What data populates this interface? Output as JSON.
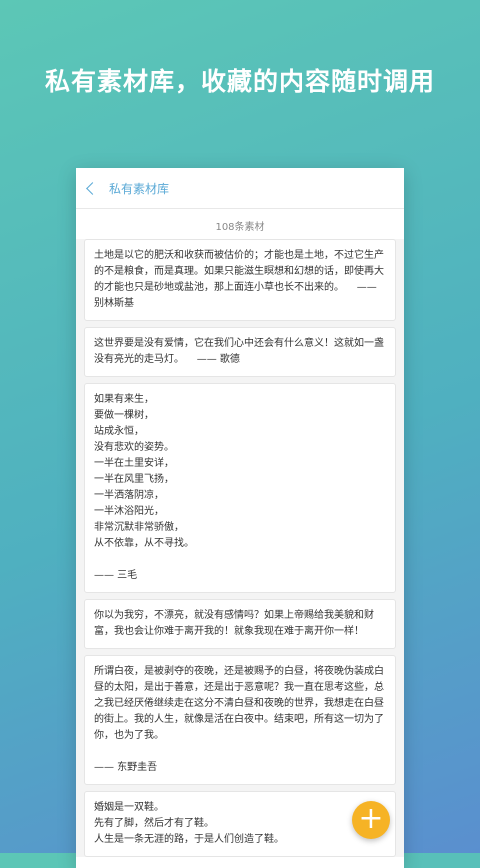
{
  "headline": "私有素材库，收藏的内容随时调用",
  "nav": {
    "title": "私有素材库"
  },
  "count_label": "108条素材",
  "cards": [
    {
      "text": "土地是以它的肥沃和收获而被估价的；才能也是土地，不过它生产的不是粮食，而是真理。如果只能滋生瞑想和幻想的话，即使再大的才能也只是砂地或盐池，那上面连小草也长不出来的。    —— 别林斯基"
    },
    {
      "text": "这世界要是没有爱情，它在我们心中还会有什么意义！这就如一盏没有亮光的走马灯。    —— 歌德"
    },
    {
      "text": "如果有来生，\n要做一棵树，\n站成永恒，\n没有悲欢的姿势。\n一半在土里安详，\n一半在风里飞扬，\n一半洒落阴凉，\n一半沐浴阳光，\n非常沉默非常骄傲，\n从不依靠，从不寻找。\n\n—— 三毛"
    },
    {
      "text": "你以为我穷，不漂亮，就没有感情吗？如果上帝赐给我美貌和财富，我也会让你难于离开我的！就象我现在难于离开你一样！"
    },
    {
      "text": "所谓白夜，是被剥夺的夜晚，还是被赐予的白昼，将夜晚伪装成白昼的太阳，是出于善意，还是出于恶意呢？我一直在思考这些，总之我已经厌倦继续走在这分不清白昼和夜晚的世界，我想走在白昼的街上。我的人生，就像是活在白夜中。结束吧，所有这一切为了你，也为了我。\n\n—— 东野圭吾"
    },
    {
      "text": "婚姻是一双鞋。\n先有了脚，然后才有了鞋。\n人生是一条无涯的路，于是人们创造了鞋。"
    }
  ],
  "fab_label": "+"
}
